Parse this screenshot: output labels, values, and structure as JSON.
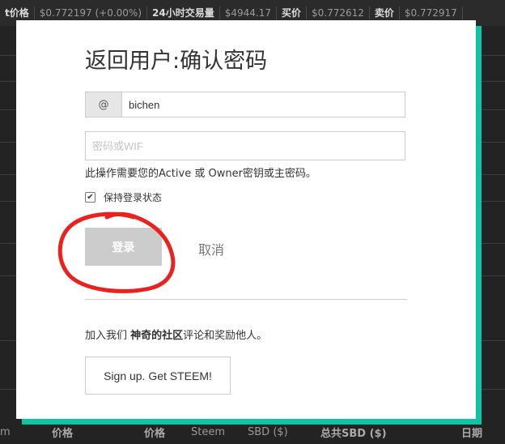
{
  "background": {
    "ticker": [
      {
        "text": "t价格",
        "style": "bold"
      },
      {
        "text": "$0.772197 (+0.00%)",
        "style": "muted"
      },
      {
        "text": "24小时交易量",
        "style": "bold"
      },
      {
        "text": "$4944.17",
        "style": "muted"
      },
      {
        "text": "买价",
        "style": "bold"
      },
      {
        "text": "$0.772612",
        "style": "muted"
      },
      {
        "text": "卖价",
        "style": "bold"
      },
      {
        "text": "$0.772917",
        "style": "muted"
      }
    ],
    "footer": {
      "col0": "m",
      "col1": "价格",
      "col2": "价格",
      "col3": "Steem",
      "col4": "SBD ($)",
      "col5": "总共SBD ($)",
      "col6": "日期"
    }
  },
  "modal": {
    "title": "返回用户:确认密码",
    "username_prefix": "@",
    "username_value": "bichen",
    "password_placeholder": "密码或WIF",
    "hint": "此操作需要您的Active 或 Owner密钥或主密码。",
    "remember_label": "保持登录状态",
    "remember_checked": true,
    "login_label": "登录",
    "cancel_label": "取消",
    "community_prefix": "加入我们 ",
    "community_bold": "神奇的社区",
    "community_suffix": "评论和奖励他人。",
    "signup_label": "Sign up. Get STEEM!"
  },
  "colors": {
    "accent_border": "#0fc4a0",
    "annotation_circle": "#e8231f",
    "button_disabled": "#cccccc"
  }
}
